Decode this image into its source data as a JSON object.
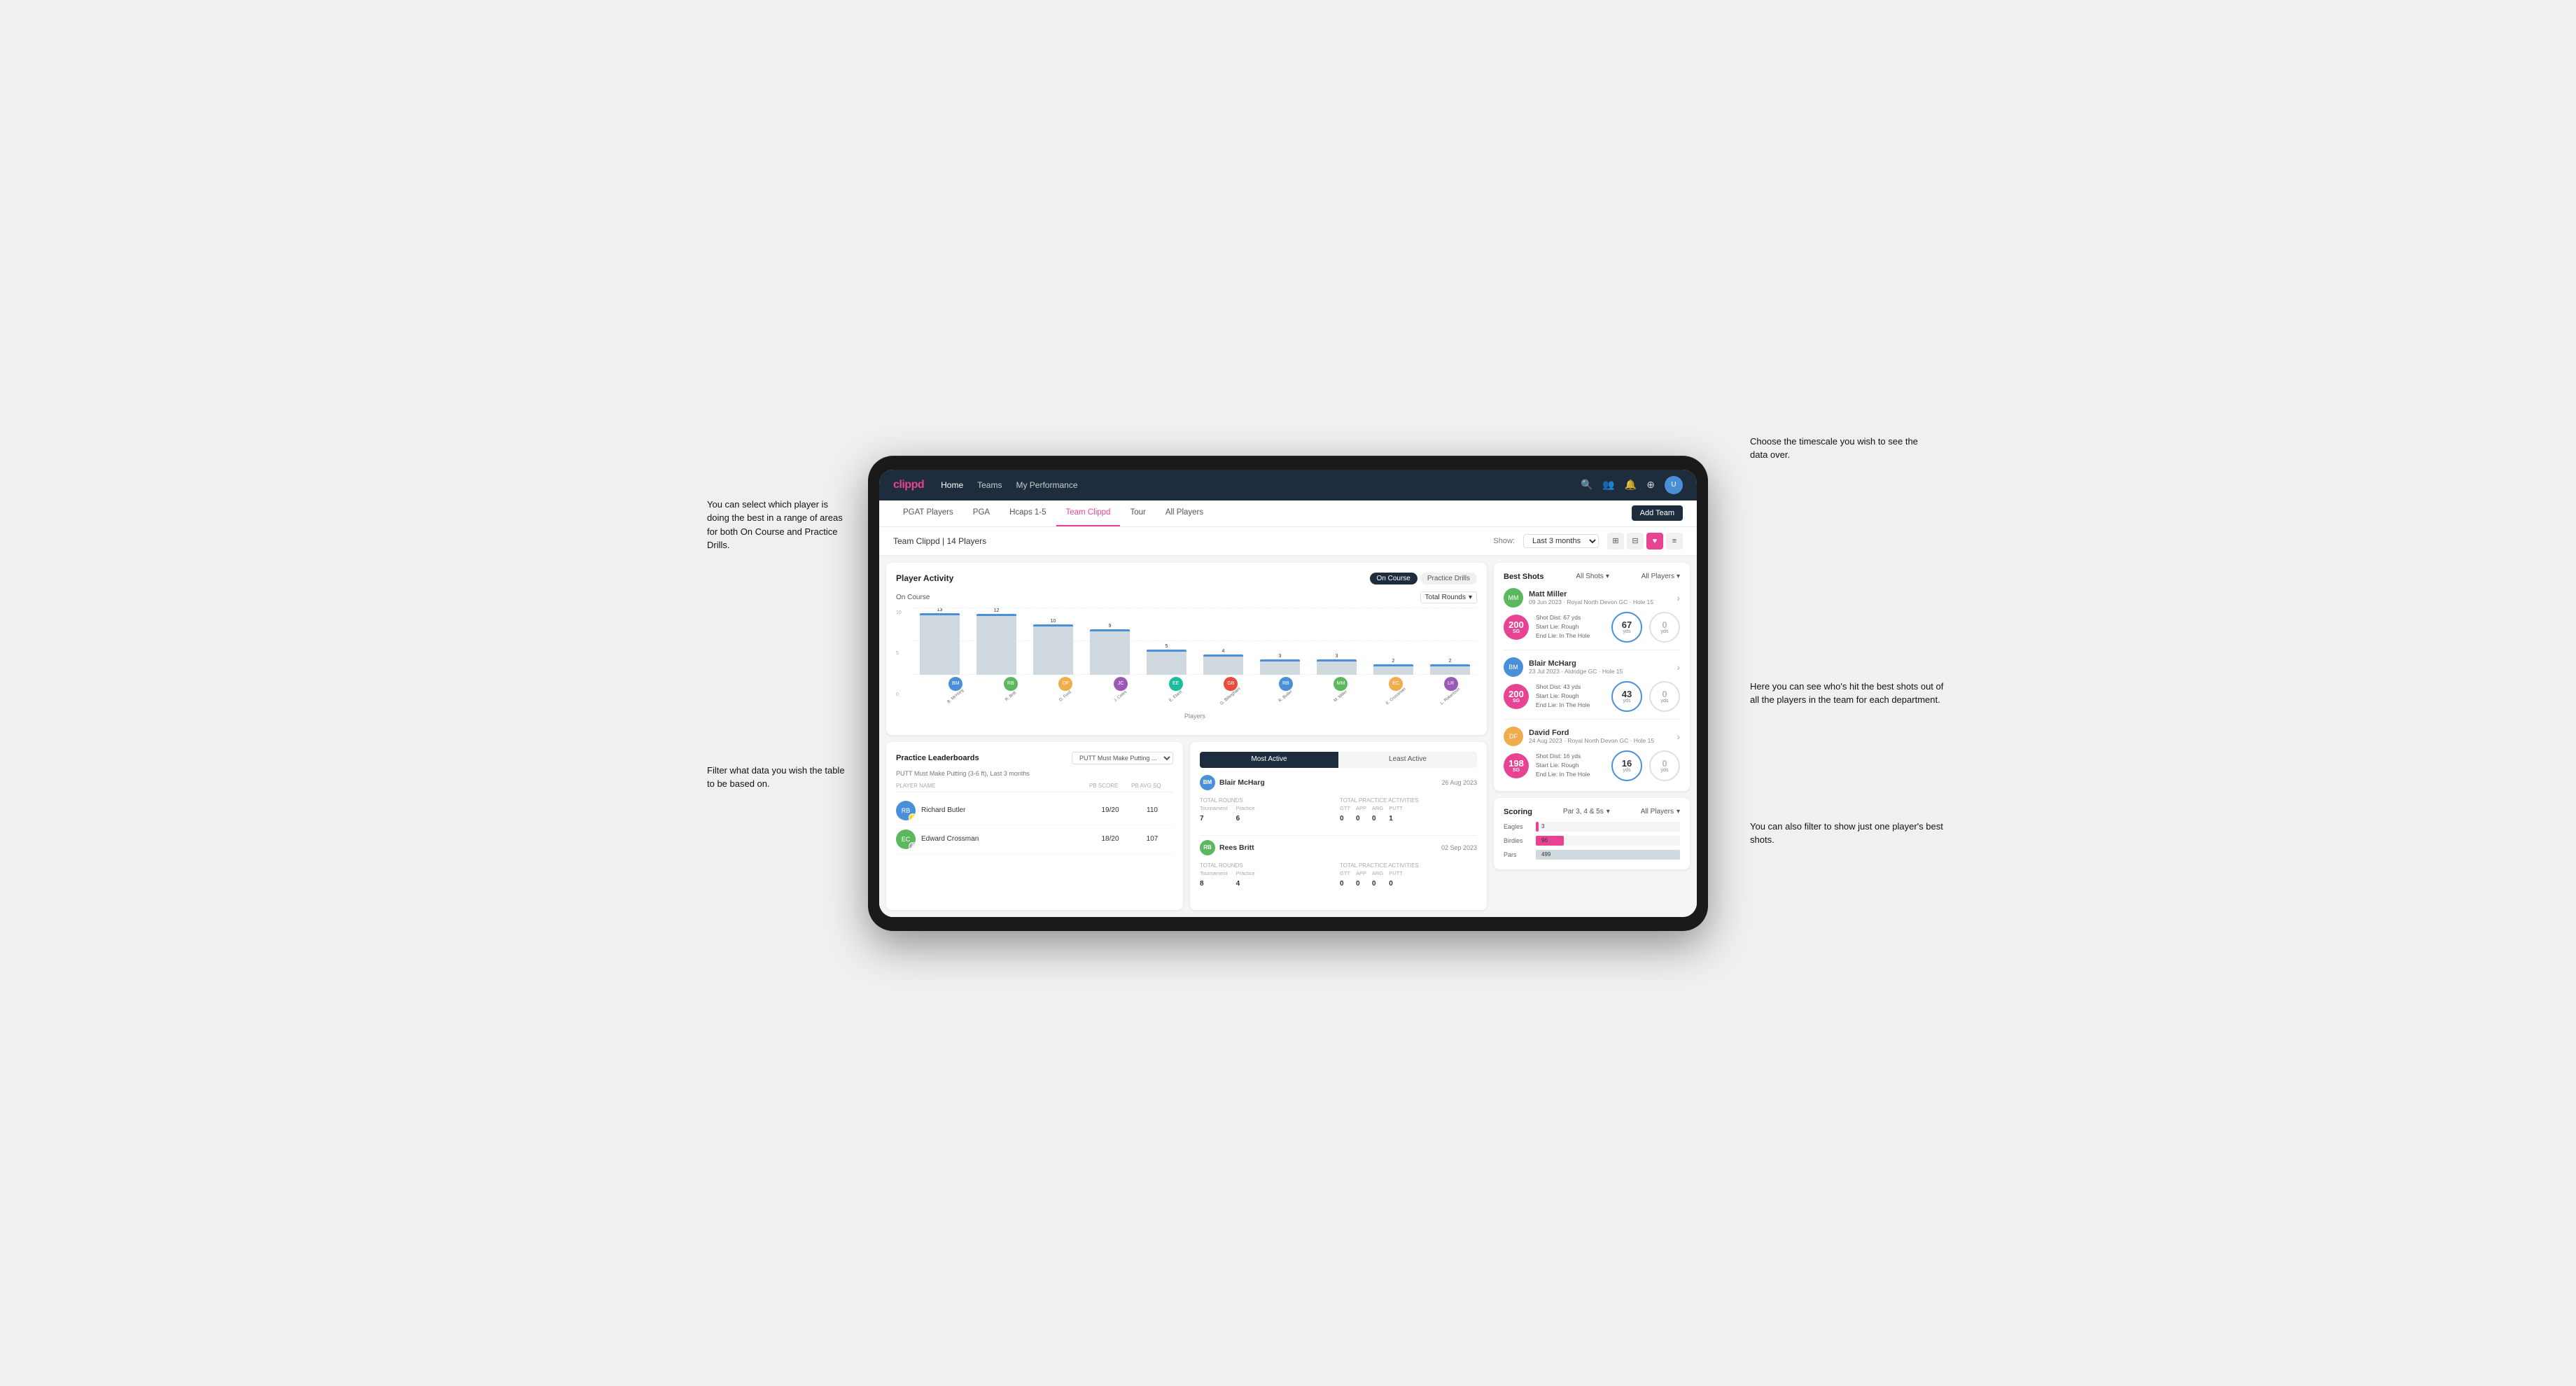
{
  "annotations": {
    "top_left": "You can select which player is doing the best in a range of areas for both On Course and Practice Drills.",
    "bottom_left": "Filter what data you wish the table to be based on.",
    "top_right": "Choose the timescale you wish to see the data over.",
    "middle_right": "Here you can see who's hit the best shots out of all the players in the team for each department.",
    "bottom_right": "You can also filter to show just one player's best shots."
  },
  "nav": {
    "logo": "clippd",
    "links": [
      "Home",
      "Teams",
      "My Performance"
    ],
    "icons": [
      "search",
      "people",
      "bell",
      "plus",
      "user"
    ]
  },
  "sub_tabs": {
    "tabs": [
      "PGAT Players",
      "PGA",
      "Hcaps 1-5",
      "Team Clippd",
      "Tour",
      "All Players"
    ],
    "active": "Team Clippd",
    "add_button": "Add Team"
  },
  "team_header": {
    "name": "Team Clippd | 14 Players",
    "show_label": "Show:",
    "time_select": "Last 3 months",
    "view_options": [
      "grid-2",
      "grid-4",
      "heart",
      "list"
    ]
  },
  "player_activity": {
    "title": "Player Activity",
    "tabs": [
      "On Course",
      "Practice Drills"
    ],
    "active_tab": "On Course",
    "section_label": "On Course",
    "chart_dropdown": "Total Rounds",
    "y_labels": [
      "0",
      "5",
      "10"
    ],
    "bars": [
      {
        "name": "B. McHarg",
        "value": 13,
        "initials": "BM",
        "color": "#4a90d9"
      },
      {
        "name": "R. Britt",
        "value": 12,
        "initials": "RB",
        "color": "#5cb85c"
      },
      {
        "name": "D. Ford",
        "value": 10,
        "initials": "DF",
        "color": "#f0ad4e"
      },
      {
        "name": "J. Coles",
        "value": 9,
        "initials": "JC",
        "color": "#9b59b6"
      },
      {
        "name": "E. Ebert",
        "value": 5,
        "initials": "EE",
        "color": "#1abc9c"
      },
      {
        "name": "G. Billingham",
        "value": 4,
        "initials": "GB",
        "color": "#e74c3c"
      },
      {
        "name": "R. Butler",
        "value": 3,
        "initials": "RB",
        "color": "#4a90d9"
      },
      {
        "name": "M. Miller",
        "value": 3,
        "initials": "MM",
        "color": "#5cb85c"
      },
      {
        "name": "E. Crossman",
        "value": 2,
        "initials": "EC",
        "color": "#f0ad4e"
      },
      {
        "name": "L. Robertson",
        "value": 2,
        "initials": "LR",
        "color": "#9b59b6"
      }
    ],
    "x_label": "Players",
    "total_rounds_label": "Total Rounds"
  },
  "practice_leaderboards": {
    "title": "Practice Leaderboards",
    "dropdown": "PUTT Must Make Putting ...",
    "subtitle": "PUTT Must Make Putting (3-6 ft), Last 3 months",
    "columns": [
      "PLAYER NAME",
      "PB SCORE",
      "PB AVG SQ"
    ],
    "players": [
      {
        "name": "Richard Butler",
        "initials": "RB",
        "color": "#4a90d9",
        "rank": 1,
        "pb_score": "19/20",
        "pb_avg": "110"
      },
      {
        "name": "Edward Crossman",
        "initials": "EC",
        "color": "#5cb85c",
        "rank": 2,
        "pb_score": "18/20",
        "pb_avg": "107"
      }
    ]
  },
  "most_active": {
    "tabs": [
      "Most Active",
      "Least Active"
    ],
    "active_tab": "Most Active",
    "players": [
      {
        "name": "Blair McHarg",
        "initials": "BM",
        "color": "#4a90d9",
        "date": "26 Aug 2023",
        "total_rounds_label": "Total Rounds",
        "tournament": 7,
        "practice": 6,
        "total_practice_label": "Total Practice Activities",
        "gtt": 0,
        "app": 0,
        "arg": 0,
        "putt": 1
      },
      {
        "name": "Rees Britt",
        "initials": "RB",
        "color": "#5cb85c",
        "date": "02 Sep 2023",
        "total_rounds_label": "Total Rounds",
        "tournament": 8,
        "practice": 4,
        "total_practice_label": "Total Practice Activities",
        "gtt": 0,
        "app": 0,
        "arg": 0,
        "putt": 0
      }
    ]
  },
  "best_shots": {
    "title": "Best Shots",
    "filter1": "All Shots",
    "filter2": "All Players",
    "players": [
      {
        "name": "Matt Miller",
        "initials": "MM",
        "color": "#5cb85c",
        "date": "09 Jun 2023",
        "course": "Royal North Devon GC",
        "hole": "Hole 15",
        "badge_num": "200",
        "badge_sub": "SG",
        "shot_dist": "Shot Dist: 67 yds",
        "start_lie": "Start Lie: Rough",
        "end_lie": "End Lie: In The Hole",
        "metric1": 67,
        "metric1_unit": "yds",
        "metric2": 0,
        "metric2_unit": "yds"
      },
      {
        "name": "Blair McHarg",
        "initials": "BM",
        "color": "#4a90d9",
        "date": "23 Jul 2023",
        "course": "Aldridge GC",
        "hole": "Hole 15",
        "badge_num": "200",
        "badge_sub": "SG",
        "shot_dist": "Shot Dist: 43 yds",
        "start_lie": "Start Lie: Rough",
        "end_lie": "End Lie: In The Hole",
        "metric1": 43,
        "metric1_unit": "yds",
        "metric2": 0,
        "metric2_unit": "yds"
      },
      {
        "name": "David Ford",
        "initials": "DF",
        "color": "#f0ad4e",
        "date": "24 Aug 2023",
        "course": "Royal North Devon GC",
        "hole": "Hole 15",
        "badge_num": "198",
        "badge_sub": "SG",
        "shot_dist": "Shot Dist: 16 yds",
        "start_lie": "Start Lie: Rough",
        "end_lie": "End Lie: In The Hole",
        "metric1": 16,
        "metric1_unit": "yds",
        "metric2": 0,
        "metric2_unit": "yds"
      }
    ]
  },
  "scoring": {
    "title": "Scoring",
    "filter1": "Par 3, 4 & 5s",
    "filter2": "All Players",
    "bars": [
      {
        "label": "Eagles",
        "value": 3,
        "color": "#e84393",
        "max": 500
      },
      {
        "label": "Birdies",
        "value": 96,
        "color": "#e84393",
        "max": 500
      },
      {
        "label": "Pars",
        "value": 499,
        "color": "#d0d8e0",
        "max": 500
      }
    ]
  }
}
